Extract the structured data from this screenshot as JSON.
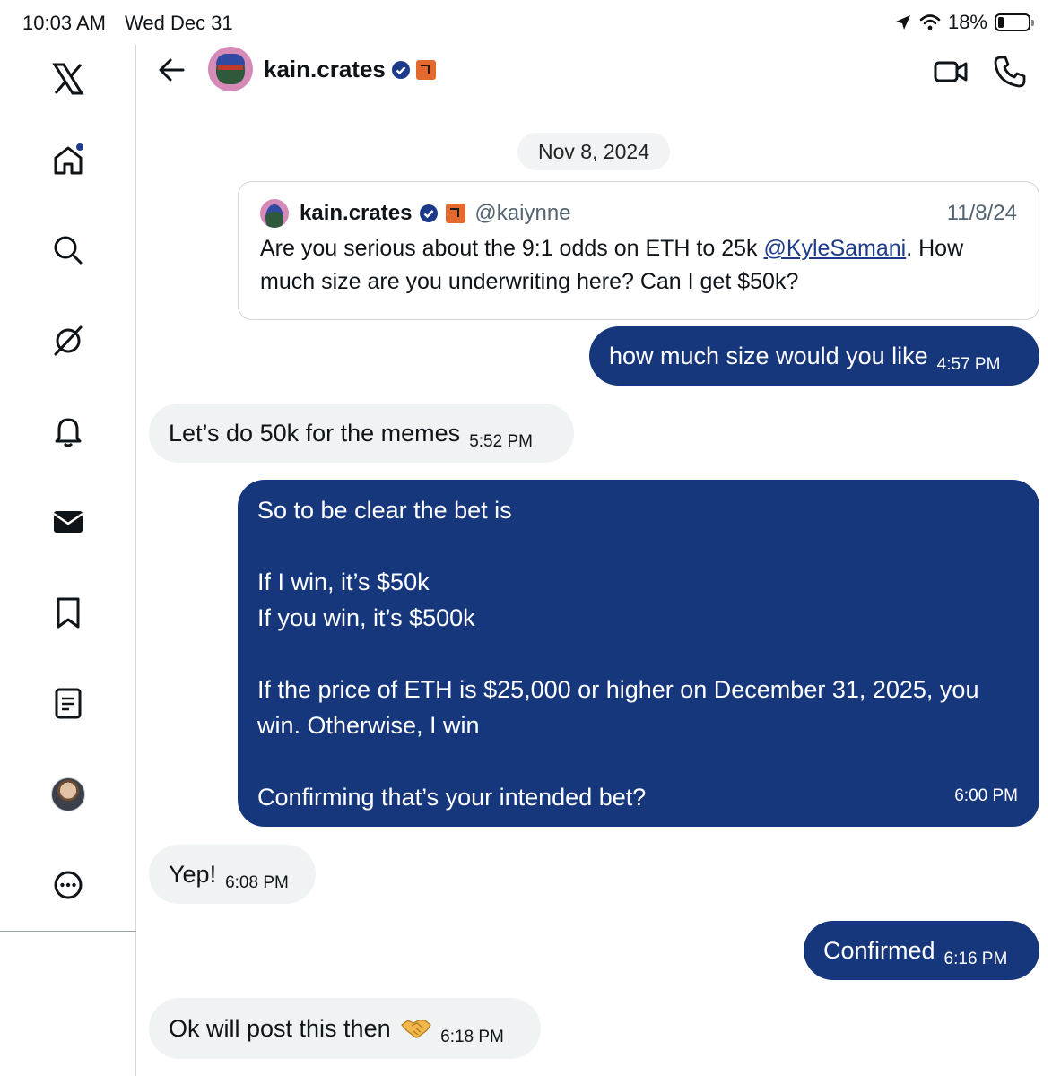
{
  "status_bar": {
    "time": "10:03 AM",
    "date": "Wed Dec 31",
    "battery": "18%"
  },
  "sidebar": {
    "items": [
      {
        "icon": "x-logo-icon"
      },
      {
        "icon": "home-icon",
        "notification_dot": true
      },
      {
        "icon": "search-icon"
      },
      {
        "icon": "grok-icon"
      },
      {
        "icon": "bell-icon"
      },
      {
        "icon": "mail-icon"
      },
      {
        "icon": "bookmark-icon"
      },
      {
        "icon": "list-icon"
      },
      {
        "icon": "profile-avatar"
      },
      {
        "icon": "more-icon"
      }
    ]
  },
  "header": {
    "contact_name": "kain.crates",
    "verified": true
  },
  "conversation": {
    "date_label": "Nov 8, 2024",
    "quoted_post": {
      "name": "kain.crates",
      "handle": "@kaiynne",
      "date": "11/8/24",
      "text_before": "Are you serious about the 9:1 odds on ETH to 25k ",
      "mention": "@KyleSamani",
      "text_after": ". How much size are you underwriting here? Can I get $50k?"
    },
    "messages": [
      {
        "direction": "out",
        "text": "how much size would you like",
        "time": "4:57 PM"
      },
      {
        "direction": "in",
        "text": "Let’s do 50k for the memes",
        "time": "5:52 PM"
      },
      {
        "direction": "out",
        "lines": [
          "So to be clear the bet is",
          "",
          "If I win, it’s $50k",
          "If you win, it’s $500k",
          "",
          "If the price of ETH is $25,000 or higher on December 31, 2025, you",
          "win. Otherwise, I win",
          "",
          "Confirming that’s your intended bet?"
        ],
        "time": "6:00 PM"
      },
      {
        "direction": "in",
        "text": "Yep!",
        "time": "6:08 PM"
      },
      {
        "direction": "out",
        "text": "Confirmed",
        "time": "6:16 PM"
      },
      {
        "direction": "in",
        "text": "Ok will post this then",
        "emoji": "handshake-icon",
        "time": "6:18 PM"
      }
    ]
  },
  "colors": {
    "outgoing_bubble": "#17377d",
    "incoming_bubble": "#eff3f4",
    "mention": "#1d3b8a"
  }
}
